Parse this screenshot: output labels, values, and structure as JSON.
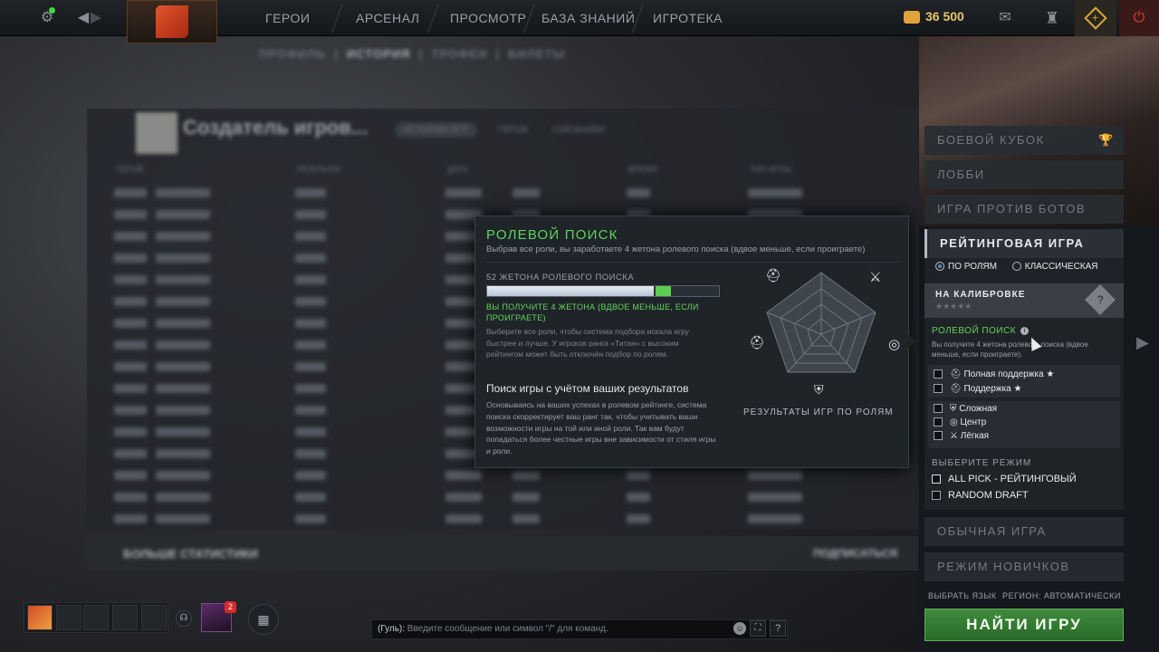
{
  "topbar": {
    "tabs": [
      "ГЕРОИ",
      "АРСЕНАЛ",
      "ПРОСМОТР",
      "БАЗА ЗНАНИЙ",
      "ИГРОТЕКА"
    ],
    "shards_amount": "36 500",
    "icons": [
      "settings-gear-icon",
      "back-arrow-icon",
      "forward-arrow-icon",
      "mail-icon",
      "armory-icon",
      "plus-battlepass-icon",
      "power-icon"
    ]
  },
  "profile_bg": {
    "subtabs": [
      "ПРОФИЛЬ",
      "ИСТОРИЯ",
      "ТРОФЕИ",
      "БИЛЕТЫ"
    ],
    "player_name": "Создатель игров...",
    "toggles": [
      "ИСТОРИЯ ИГР",
      "ГЕРОИ",
      "СОЮЗНИКИ"
    ],
    "columns": [
      "ГЕРОЙ",
      "РЕЗУЛЬТАТ",
      "ДАТА",
      "ВРЕМЯ",
      "ТИП ИГРЫ"
    ],
    "more_stats": "БОЛЬШЕ СТАТИСТИКИ",
    "subscribe": "ПОДПИСАТЬСЯ"
  },
  "popup": {
    "title": "РОЛЕВОЙ ПОИСК",
    "subtitle": "Выбрав все роли, вы заработаете 4 жетона ролевого поиска (вдвое меньше, если проиграете)",
    "tokens_label": "52 ЖЕТОНА РОЛЕВОГО ПОИСКА",
    "tokens_progress": 0.86,
    "gain_text": "ВЫ ПОЛУЧИТЕ 4 ЖЕТОНА (ВДВОЕ МЕНЬШЕ, ЕСЛИ ПРОИГРАЕТЕ)",
    "note": "Выберите все роли, чтобы система подбора искала игру быстрее и лучше. У игроков ранга «Титан» с высоким рейтингом может быть отключён подбор по ролям.",
    "section_title": "Поиск игры с учётом ваших результатов",
    "section_text": "Основываясь на ваших успехах в ролевом рейтинге, система поиска скорректирует ваш ранг так, чтобы учитывать ваши возможности игры на той или иной роли. Так вам будут попадаться более честные игры вне зависимости от стиля игры и роли.",
    "radar_caption": "РЕЗУЛЬТАТЫ ИГР ПО РОЛЯМ",
    "radar_icons": [
      "hard-support-icon",
      "carry-sword-icon",
      "offlane-icon",
      "mid-lane-icon",
      "soft-support-icon"
    ]
  },
  "rightpanel": {
    "menu_top": [
      "БОЕВОЙ КУБОК",
      "ЛОББИ",
      "ИГРА ПРОТИВ БОТОВ"
    ],
    "ranked_title": "РЕЙТИНГОВАЯ ИГРА",
    "radio_roles": "ПО РОЛЯМ",
    "radio_classic": "КЛАССИЧЕСКАЯ",
    "calibration": "НА КАЛИБРОВКЕ",
    "role_search_title": "РОЛЕВОЙ ПОИСК",
    "role_search_desc": "Вы получите 4 жетона ролевого поиска (вдвое меньше, если проиграете).",
    "roles": [
      "Полная поддержка",
      "Поддержка",
      "Сложная",
      "Центр",
      "Лёгкая"
    ],
    "mode_title": "ВЫБЕРИТЕ РЕЖИМ",
    "modes": [
      "ALL PICK - РЕЙТИНГОВЫЙ",
      "RANDOM DRAFT"
    ],
    "menu_bottom": [
      "ОБЫЧНАЯ ИГРА",
      "РЕЖИМ НОВИЧКОВ"
    ],
    "language": "ВЫБРАТЬ ЯЗЫК",
    "region": "РЕГИОН: АВТОМАТИЧЕСКИ",
    "find_button": "НАЙТИ ИГРУ"
  },
  "bottombar": {
    "friends_badge": "2",
    "chat_prefix": "(Гуль):",
    "chat_placeholder": "Введите сообщение или символ \"/\" для команд."
  }
}
